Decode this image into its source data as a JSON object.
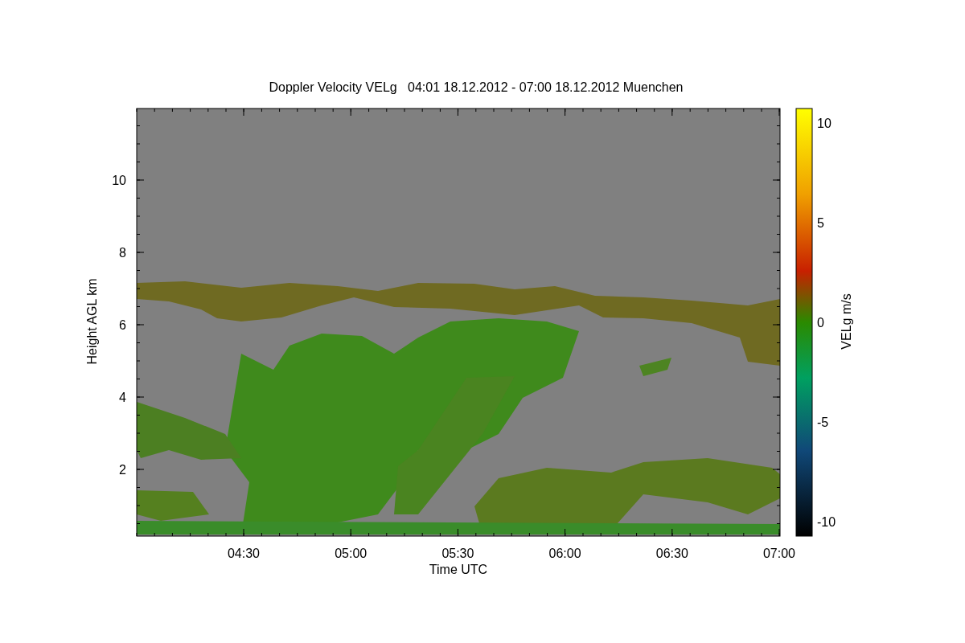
{
  "title": "Doppler Velocity VELg   04:01 18.12.2012 - 07:00 18.12.2012 Muenchen",
  "ylabel": "Height AGL km",
  "xlabel": "Time UTC",
  "yticks": [
    "10",
    "8",
    "6",
    "4",
    "2"
  ],
  "xticks": [
    "04:30",
    "05:00",
    "05:30",
    "06:00",
    "06:30",
    "07:00"
  ],
  "colorbar": {
    "label": "VELg m/s",
    "ticks": [
      "10",
      "5",
      "0",
      "-5",
      "-10"
    ]
  }
}
